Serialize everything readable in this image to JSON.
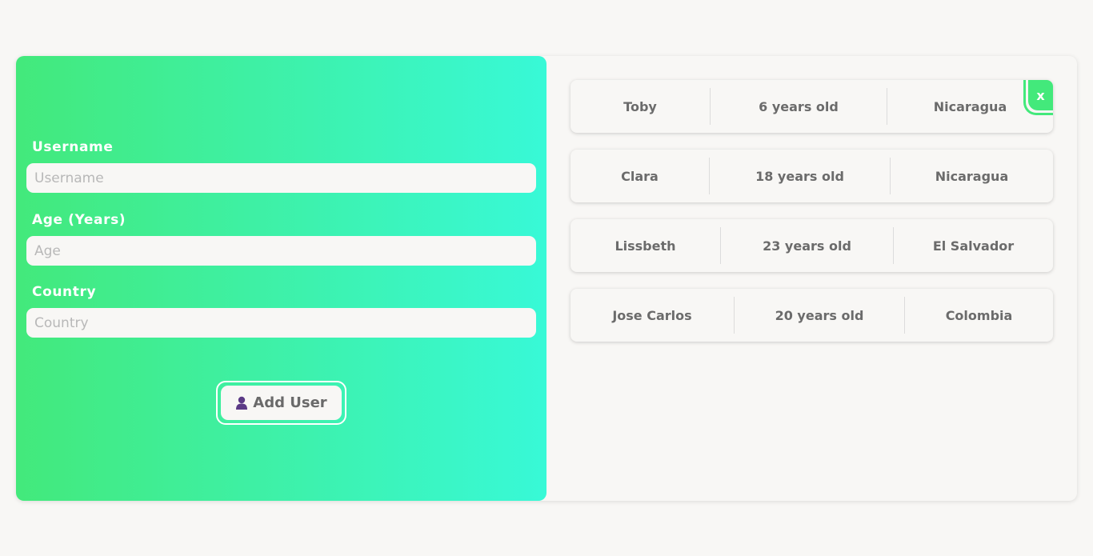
{
  "form": {
    "username_label": "Username",
    "username_placeholder": "Username",
    "age_label": "Age (Years)",
    "age_placeholder": "Age",
    "country_label": "Country",
    "country_placeholder": "Country",
    "add_button_label": "Add User",
    "add_button_icon": "user-icon"
  },
  "colors": {
    "gradient_start": "#43e97b",
    "gradient_end": "#38f9d7",
    "accent": "#43e97b",
    "icon_purple": "#5b3a86"
  },
  "users": [
    {
      "name": "Toby",
      "age": "6 years old",
      "country": "Nicaragua"
    },
    {
      "name": "Clara",
      "age": "18 years old",
      "country": "Nicaragua"
    },
    {
      "name": "Lissbeth",
      "age": "23 years old",
      "country": "El Salvador"
    },
    {
      "name": "Jose Carlos",
      "age": "20 years old",
      "country": "Colombia"
    }
  ],
  "delete_label": "x"
}
